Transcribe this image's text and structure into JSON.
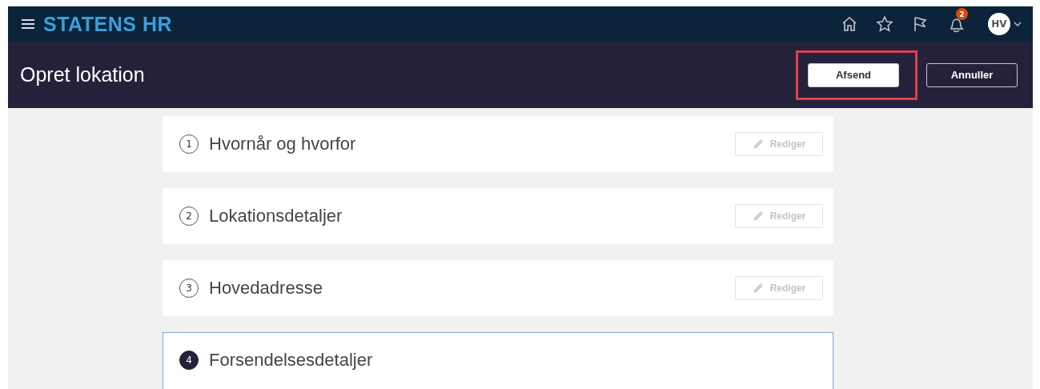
{
  "top_bar": {
    "brand": "STATENS HR",
    "notifications_badge": "2",
    "avatar_initials": "HV"
  },
  "page_header": {
    "title": "Opret lokation",
    "buttons": [
      {
        "label": "Afsend",
        "kind": "primary",
        "highlighted": true
      },
      {
        "label": "Annuller",
        "kind": "secondary",
        "highlighted": false
      }
    ]
  },
  "steps": [
    {
      "number": "1",
      "title": "Hvornår og hvorfor",
      "active": false,
      "edit_button": {
        "label": "Rediger",
        "disabled": true
      }
    },
    {
      "number": "2",
      "title": "Lokationsdetaljer",
      "active": false,
      "edit_button": {
        "label": "Rediger",
        "disabled": true
      }
    },
    {
      "number": "3",
      "title": "Hovedadresse",
      "active": false,
      "edit_button": {
        "label": "Rediger",
        "disabled": true
      }
    },
    {
      "number": "4",
      "title": "Forsendelsesdetaljer",
      "active": true
    }
  ]
}
